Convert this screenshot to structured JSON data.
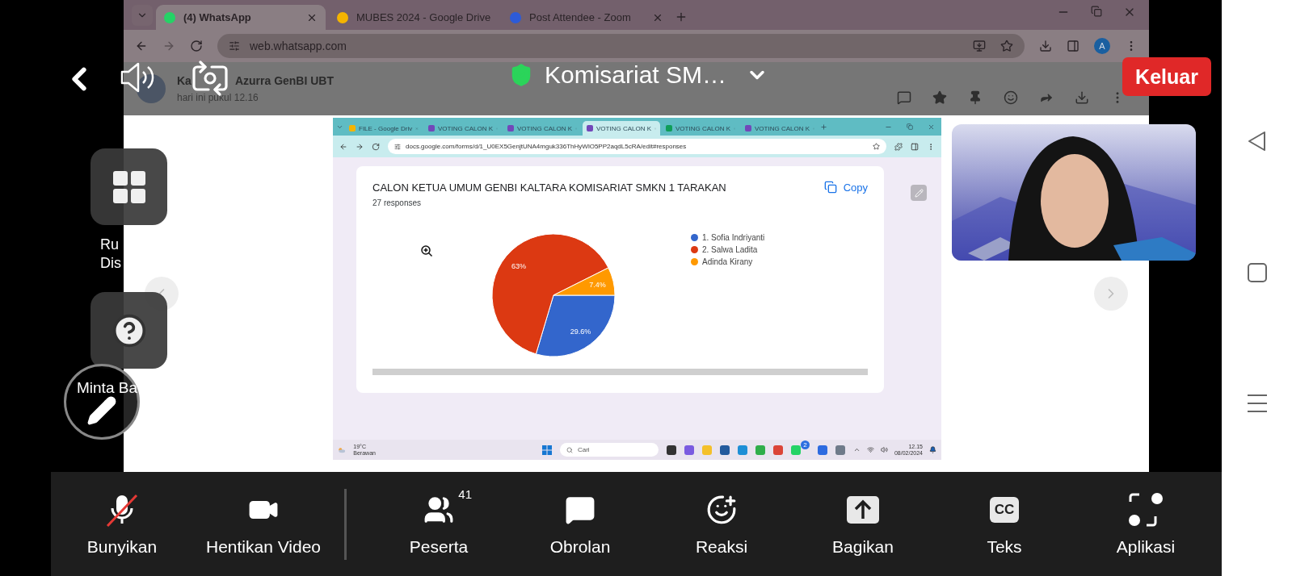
{
  "zoom_top_bar": {
    "meeting_title": "Komisariat SM…",
    "leave_button": "Keluar"
  },
  "browser": {
    "tabs": [
      {
        "title": "(4) WhatsApp",
        "kind": "whatsapp",
        "selected": true
      },
      {
        "title": "MUBES 2024 - Google Drive",
        "kind": "drive",
        "selected": false
      },
      {
        "title": "Post Attendee - Zoom",
        "kind": "zoom",
        "selected": false
      }
    ],
    "address": "web.whatsapp.com",
    "profile_initial": "A"
  },
  "chat_header": {
    "name_parts": [
      "Ka",
      "Azurra GenBI UBT"
    ],
    "status": "hari ini pukul 12.16"
  },
  "shared_window": {
    "tabs": [
      {
        "title": "FILE - Google Driv",
        "kind": "drive",
        "selected": false
      },
      {
        "title": "VOTING CALON K",
        "kind": "forms",
        "selected": false
      },
      {
        "title": "VOTING CALON K",
        "kind": "forms",
        "selected": false
      },
      {
        "title": "VOTING CALON K",
        "kind": "forms",
        "selected": true
      },
      {
        "title": "VOTING CALON K",
        "kind": "sheets",
        "selected": false
      },
      {
        "title": "VOTING CALON K",
        "kind": "forms",
        "selected": false
      }
    ],
    "address": "docs.google.com/forms/d/1_U0EX5GenjtUNA4mguk336ThHyWlO5PP2aqdL5cRA/edit#responses",
    "card": {
      "title": "CALON KETUA UMUM GENBI KALTARA KOMISARIAT SMKN 1 TARAKAN",
      "responses": "27 responses",
      "copy_button": "Copy",
      "legend": [
        {
          "color": "#3366cc"
        },
        {
          "color": "#dc3912"
        },
        {
          "color": "#ff9900"
        }
      ],
      "chart_data": {
        "type": "pie",
        "categories": [
          "1. Sofia Indriyanti",
          "2. Salwa Ladita",
          "Adinda Kirany"
        ],
        "values": [
          29.6,
          63,
          7.4
        ],
        "data_labels": true,
        "value_labels": [
          "29.6%",
          "63%",
          "7.4%"
        ]
      }
    },
    "taskbar": {
      "temperature": "19°C",
      "weather": "Berawan",
      "search_placeholder": "Cari",
      "whatsapp_badge": "2",
      "time": "12.15",
      "date": "08/02/2024"
    }
  },
  "side_buttons": [
    {
      "kind": "grid",
      "label_lines": [
        "Ru",
        "Dis"
      ]
    },
    {
      "kind": "help",
      "label_lines": [
        "Minta Ba"
      ]
    }
  ],
  "toolbar": {
    "media": [
      {
        "kind": "mic",
        "label": "Bunyikan",
        "muted": true
      },
      {
        "kind": "video",
        "label": "Hentikan Video"
      }
    ],
    "actions": [
      {
        "kind": "participants",
        "label": "Peserta",
        "count": "41"
      },
      {
        "kind": "chat",
        "label": "Obrolan"
      },
      {
        "kind": "reactions",
        "label": "Reaksi"
      },
      {
        "kind": "share",
        "label": "Bagikan"
      },
      {
        "kind": "captions",
        "label": "Teks",
        "icon_text": "CC"
      },
      {
        "kind": "apps",
        "label": "Aplikasi"
      }
    ]
  }
}
